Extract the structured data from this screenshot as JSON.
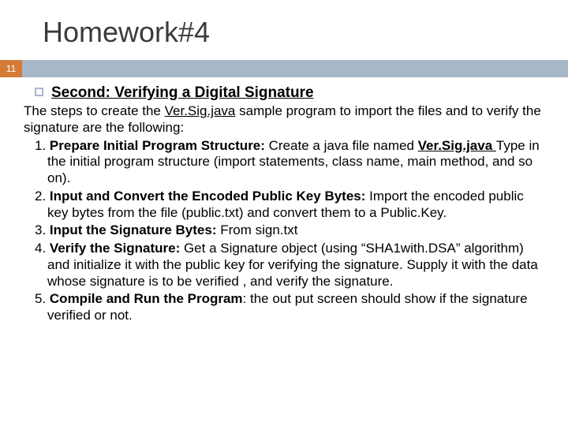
{
  "title": "Homework#4",
  "badge": "11",
  "heading": "Second: Verifying a Digital Signature",
  "intro_a": "The steps to create the ",
  "intro_file": "Ver.Sig.java",
  "intro_b": " sample program to import the files and to verify the signature are the following:",
  "s1_n": "1. ",
  "s1_t": "Prepare Initial Program Structure: ",
  "s1_a": "Create a java file named ",
  "s1_f": "Ver.Sig.java ",
  "s1_b": "Type in the initial program structure (import statements, class name, main method, and so on).",
  "s2_n": "2. ",
  "s2_t": "Input and Convert the Encoded Public Key Bytes: ",
  "s2_a": "Import the encoded public key bytes from the file (public.txt) and convert them to a Public.Key.",
  "s3_n": "3. ",
  "s3_t": "Input the Signature Bytes: ",
  "s3_a": "From sign.txt",
  "s4_n": "4. ",
  "s4_t": "Verify the Signature: ",
  "s4_a": "Get a Signature object (using “SHA1with.DSA” algorithm) and initialize it with the public key for verifying the signature. Supply it with the data whose signature is to be verified , and verify the signature.",
  "s5_n": "5. ",
  "s5_t": "Compile and Run the Program",
  "s5_a": ": the out put screen should show if the signature verified or not."
}
